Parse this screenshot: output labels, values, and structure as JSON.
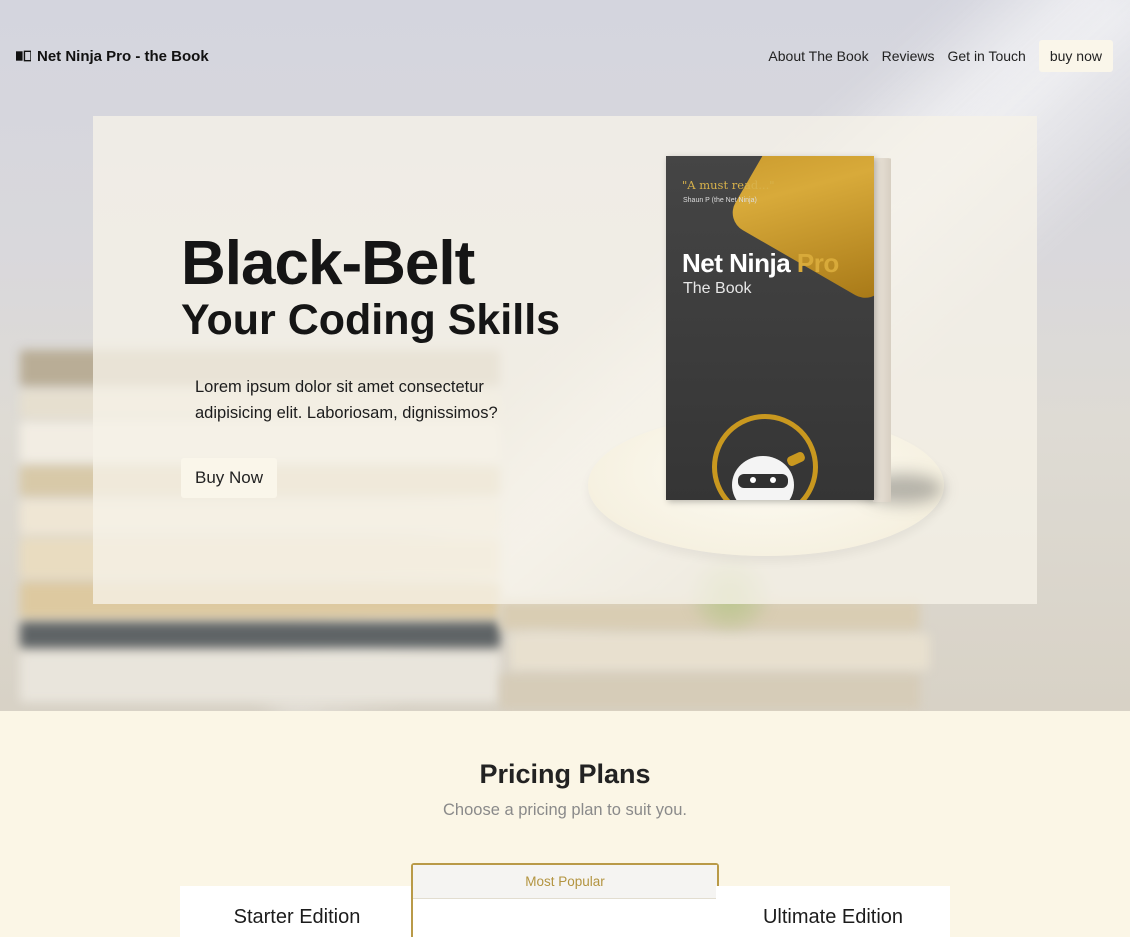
{
  "navbar": {
    "brand": "Net Ninja Pro - the Book",
    "links": [
      "About The Book",
      "Reviews",
      "Get in Touch"
    ],
    "cta": "buy now"
  },
  "hero": {
    "title": "Black-Belt",
    "subtitle": "Your Coding Skills",
    "description": "Lorem ipsum dolor sit amet consectetur adipisicing elit. Laboriosam, dignissimos?",
    "cta": "Buy Now",
    "book": {
      "quote": "\"A must read...\"",
      "quote_author": "Shaun P (the Net Ninja)",
      "title_main": "Net Ninja",
      "title_accent": "Pro",
      "subtitle": "The Book"
    }
  },
  "pricing": {
    "title": "Pricing Plans",
    "subtitle": "Choose a pricing plan to suit you.",
    "plans": [
      {
        "name": "Starter Edition"
      },
      {
        "badge": "Most Popular"
      },
      {
        "name": "Ultimate Edition"
      }
    ]
  },
  "colors": {
    "accent_gold": "#b99a48",
    "cream": "#fbf6e6",
    "button_bg": "#faf6ea"
  }
}
